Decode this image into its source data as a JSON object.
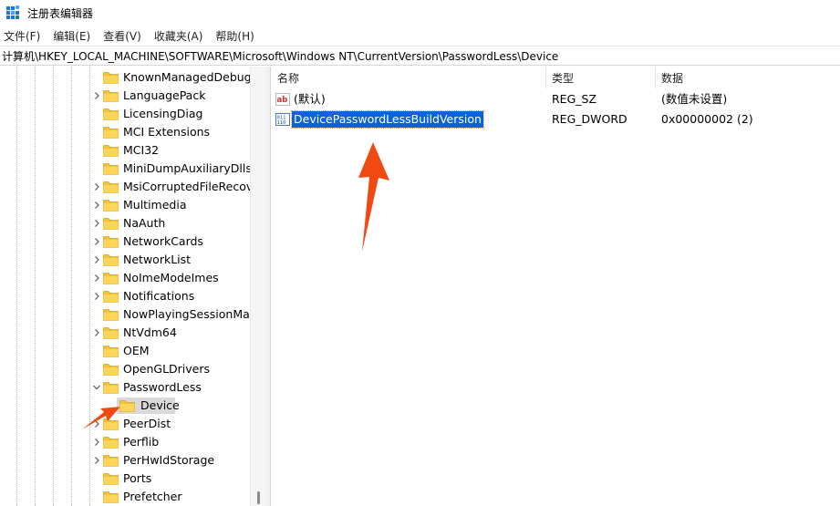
{
  "window": {
    "title": "注册表编辑器"
  },
  "menu": [
    "文件(F)",
    "编辑(E)",
    "查看(V)",
    "收藏夹(A)",
    "帮助(H)"
  ],
  "address": "计算机\\HKEY_LOCAL_MACHINE\\SOFTWARE\\Microsoft\\Windows NT\\CurrentVersion\\PasswordLess\\Device",
  "tree": [
    {
      "label": "KnownManagedDebuggingDlls",
      "expander": "none"
    },
    {
      "label": "LanguagePack",
      "expander": "collapsed"
    },
    {
      "label": "LicensingDiag",
      "expander": "none"
    },
    {
      "label": "MCI Extensions",
      "expander": "none"
    },
    {
      "label": "MCI32",
      "expander": "none"
    },
    {
      "label": "MiniDumpAuxiliaryDlls",
      "expander": "none"
    },
    {
      "label": "MsiCorruptedFileRecovery",
      "expander": "collapsed"
    },
    {
      "label": "Multimedia",
      "expander": "collapsed"
    },
    {
      "label": "NaAuth",
      "expander": "collapsed"
    },
    {
      "label": "NetworkCards",
      "expander": "collapsed"
    },
    {
      "label": "NetworkList",
      "expander": "collapsed"
    },
    {
      "label": "NoImeModeImes",
      "expander": "collapsed"
    },
    {
      "label": "Notifications",
      "expander": "collapsed"
    },
    {
      "label": "NowPlayingSessionManager",
      "expander": "none"
    },
    {
      "label": "NtVdm64",
      "expander": "collapsed"
    },
    {
      "label": "OEM",
      "expander": "none"
    },
    {
      "label": "OpenGLDrivers",
      "expander": "none"
    },
    {
      "label": "PasswordLess",
      "expander": "expanded"
    },
    {
      "label": "Device",
      "expander": "none",
      "child": true,
      "selected": true
    },
    {
      "label": "PeerDist",
      "expander": "collapsed"
    },
    {
      "label": "Perflib",
      "expander": "collapsed"
    },
    {
      "label": "PerHwIdStorage",
      "expander": "collapsed"
    },
    {
      "label": "Ports",
      "expander": "none"
    },
    {
      "label": "Prefetcher",
      "expander": "none"
    }
  ],
  "columns": {
    "name": "名称",
    "type": "类型",
    "data": "数据"
  },
  "values": [
    {
      "icon": "string-value-icon",
      "name": "(默认)",
      "type": "REG_SZ",
      "data": "(数值未设置)",
      "selected": false
    },
    {
      "icon": "dword-value-icon",
      "name": "DevicePasswordLessBuildVersion",
      "type": "REG_DWORD",
      "data": "0x00000002 (2)",
      "selected": true
    }
  ],
  "colors": {
    "selection": "#0a64d6",
    "folder": "#f3c33b",
    "annotation_arrow": "#f04a12",
    "tree_selection": "#d9d9d9"
  }
}
